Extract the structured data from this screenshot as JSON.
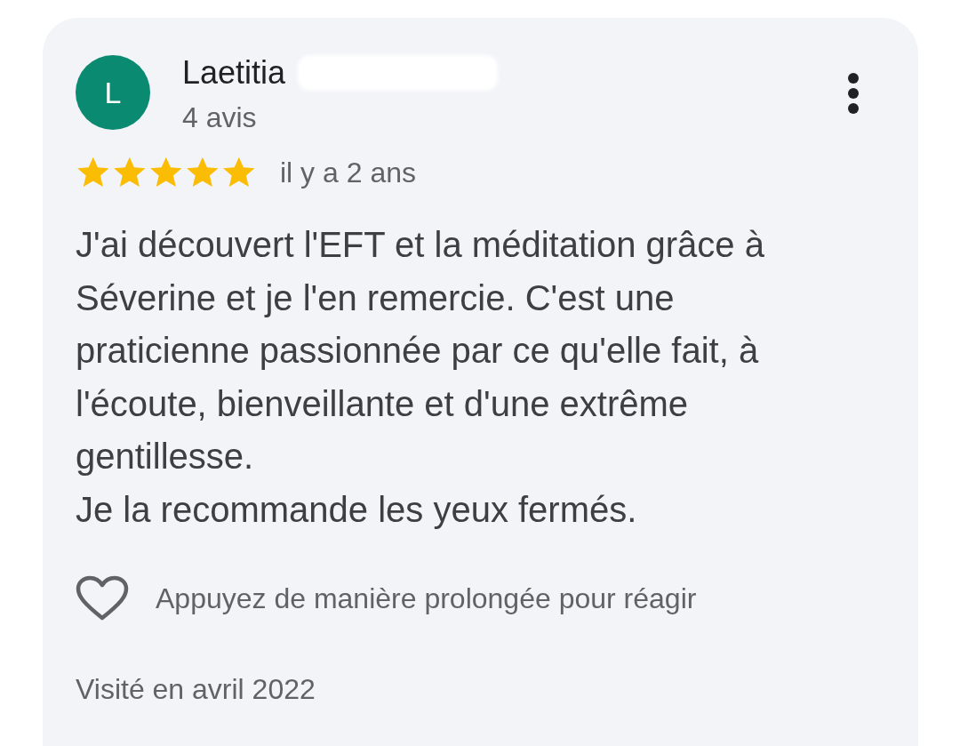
{
  "review": {
    "author": {
      "initial": "L",
      "name": "Laetitia",
      "count": "4 avis",
      "color": "#0b8a72"
    },
    "stars": 5,
    "time": "il y a 2 ans",
    "paragraphs": [
      "J'ai découvert l'EFT et la méditation grâce à Séverine et je l'en remercie. C'est une praticienne passionnée par ce qu'elle fait, à l'écoute, bienveillante et d'une extrême gentillesse.",
      "Je la recommande les yeux fermés."
    ],
    "react_hint": "Appuyez de manière prolongée pour réagir",
    "visited": "Visité en avril 2022"
  }
}
